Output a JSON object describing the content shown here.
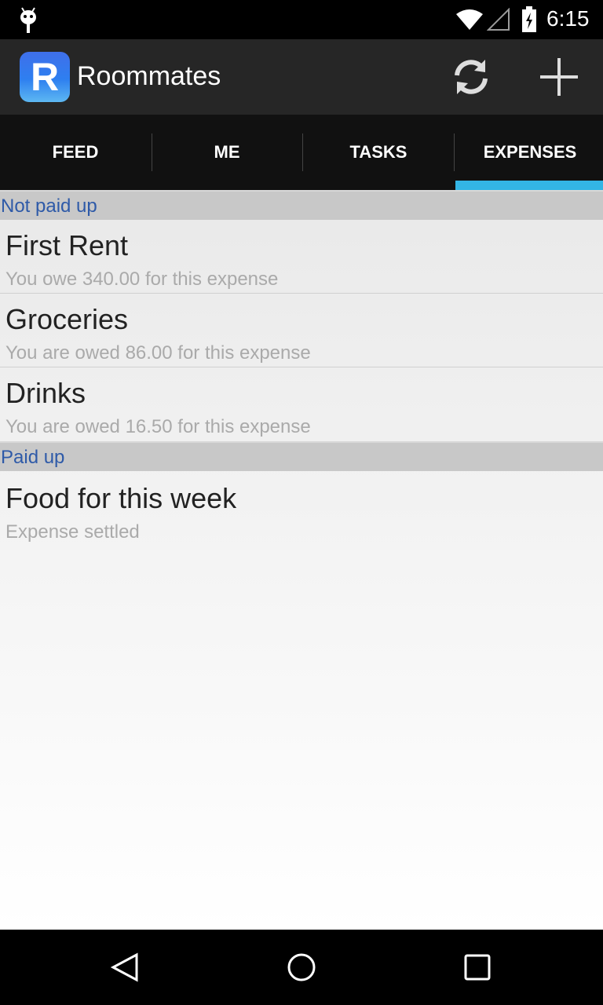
{
  "status_bar": {
    "time": "6:15"
  },
  "app": {
    "title": "Roommates",
    "logo_letter": "R"
  },
  "tabs": [
    {
      "label": "FEED",
      "selected": false
    },
    {
      "label": "ME",
      "selected": false
    },
    {
      "label": "TASKS",
      "selected": false
    },
    {
      "label": "EXPENSES",
      "selected": true
    }
  ],
  "sections": [
    {
      "header": "Not paid up",
      "items": [
        {
          "title": "First Rent",
          "subtitle": "You owe 340.00 for this expense"
        },
        {
          "title": "Groceries",
          "subtitle": "You are owed 86.00 for this expense"
        },
        {
          "title": "Drinks",
          "subtitle": "You are owed 16.50 for this expense"
        }
      ]
    },
    {
      "header": "Paid up",
      "items": [
        {
          "title": "Food for this week",
          "subtitle": "Expense settled"
        }
      ]
    }
  ],
  "colors": {
    "accent": "#33b5e5",
    "section_header_text": "#2e5aa8",
    "section_header_bg": "#c8c8c8",
    "action_bar": "#262626"
  }
}
